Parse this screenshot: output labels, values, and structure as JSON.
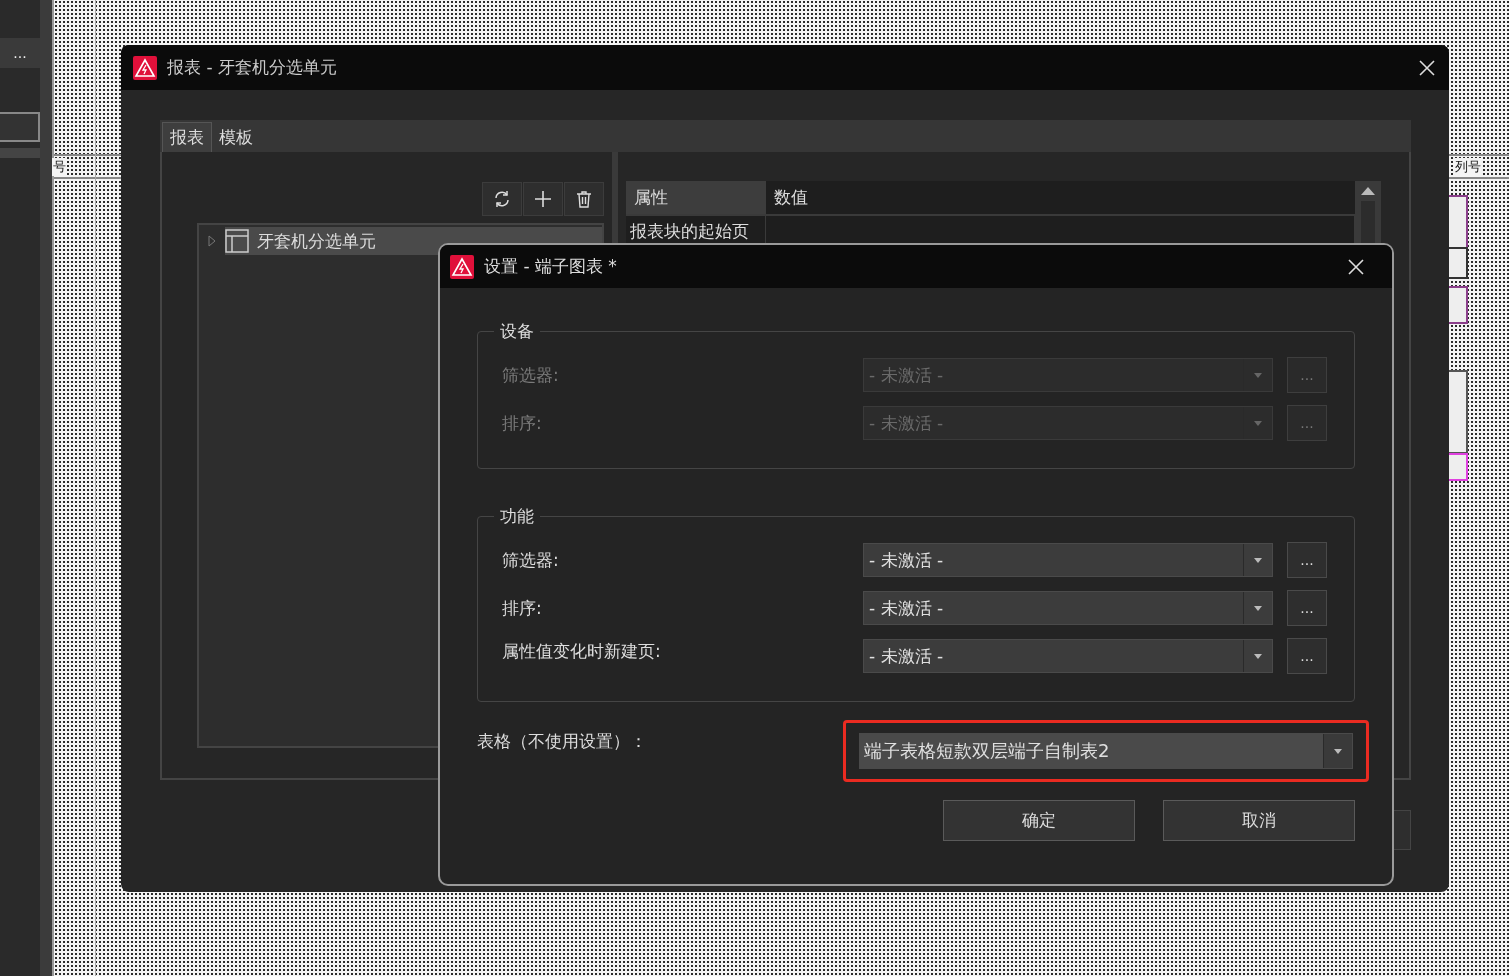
{
  "app": {
    "sidebar_button": "...",
    "canvas_labels": [
      "号",
      "列号"
    ]
  },
  "report_window": {
    "title": "报表 - 牙套机分选单元",
    "tabs": [
      {
        "label": "报表",
        "selected": true
      },
      {
        "label": "模板",
        "selected": false
      }
    ],
    "tree": [
      {
        "label": "牙套机分选单元",
        "expanded": false,
        "selected": true
      }
    ],
    "property_grid": {
      "columns": [
        "属性",
        "数值"
      ],
      "rows": [
        {
          "property": "报表块的起始页"
        }
      ]
    }
  },
  "settings_dialog": {
    "title": "设置 - 端子图表 *",
    "groups": [
      {
        "title": "设备",
        "disabled": true,
        "rows": [
          {
            "label": "筛选器:",
            "value": "- 未激活 -",
            "button": "..."
          },
          {
            "label": "排序:",
            "value": "- 未激活 -",
            "button": "..."
          }
        ]
      },
      {
        "title": "功能",
        "disabled": false,
        "rows": [
          {
            "label": "筛选器:",
            "value": "- 未激活 -",
            "button": "..."
          },
          {
            "label": "排序:",
            "value": "- 未激活 -",
            "button": "..."
          },
          {
            "label": "属性值变化时新建页:",
            "value": "- 未激活 -",
            "button": "..."
          }
        ]
      }
    ],
    "table": {
      "label": "表格（不使用设置）：",
      "value": "端子表格短款双层端子自制表2",
      "highlighted": true
    },
    "buttons": [
      "确定",
      "取消"
    ]
  }
}
